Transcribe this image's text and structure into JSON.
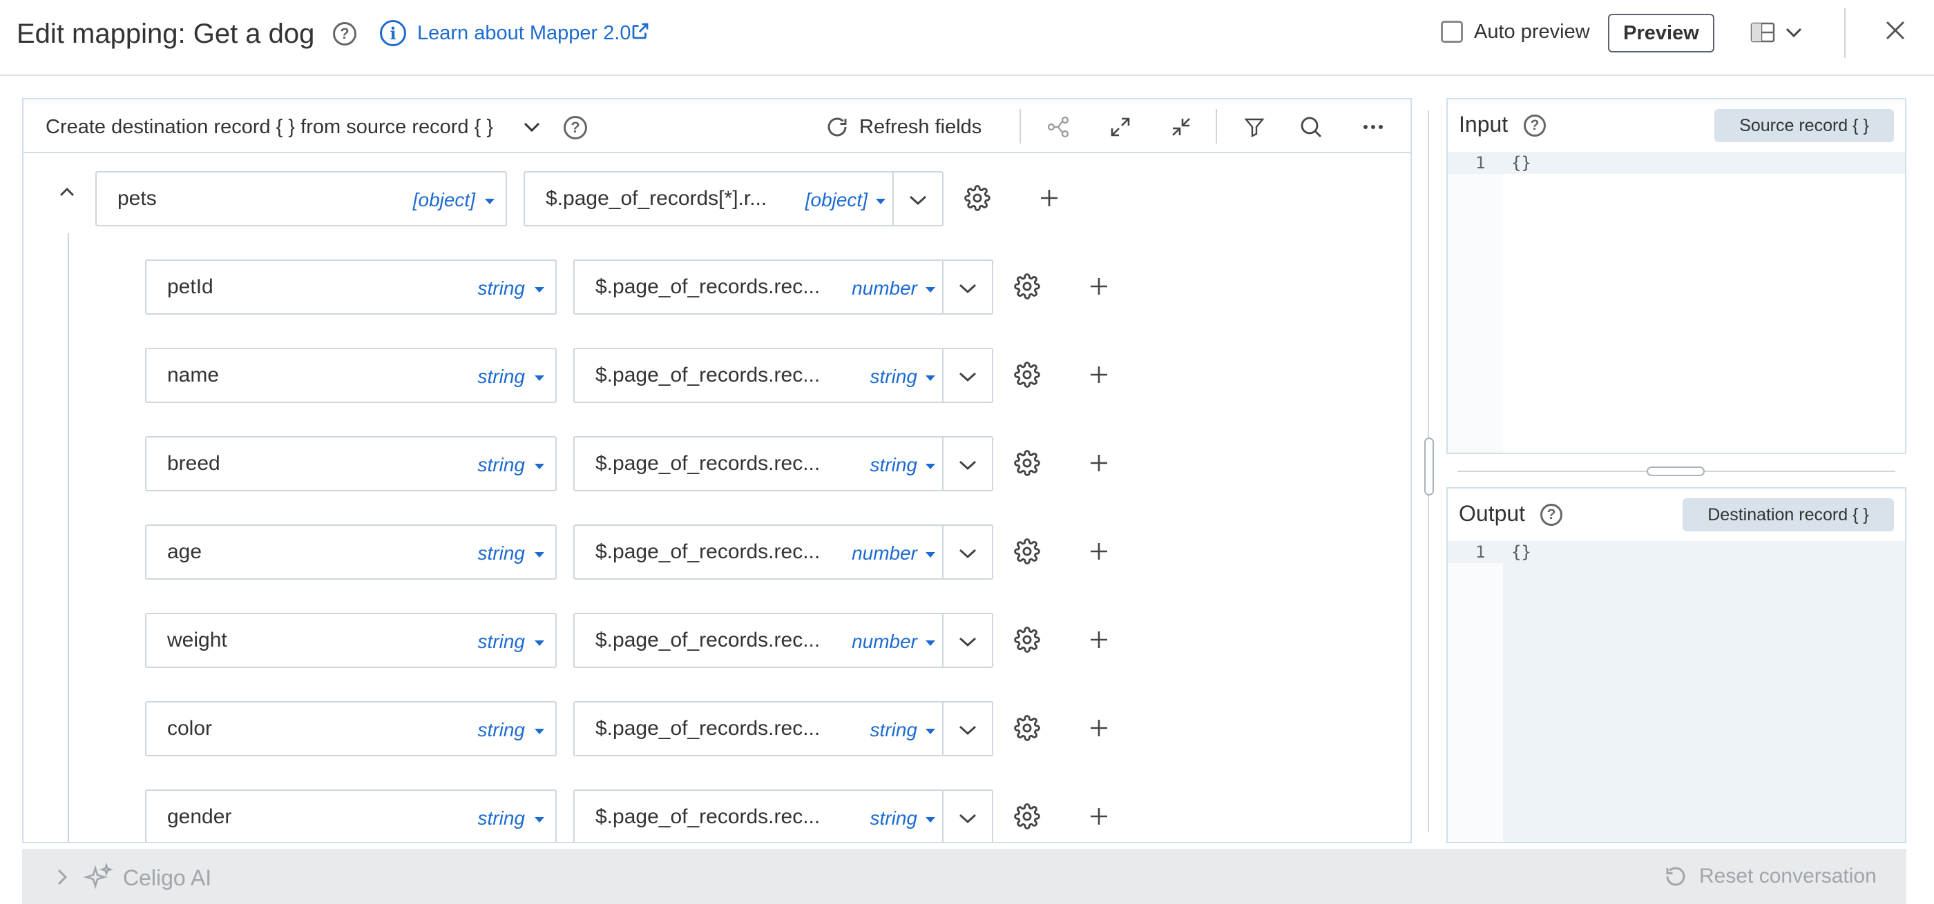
{
  "header": {
    "title": "Edit mapping: Get a dog",
    "learn_link": "Learn about Mapper 2.0",
    "auto_preview_label": "Auto preview",
    "auto_preview_checked": false,
    "preview_button": "Preview"
  },
  "toolbar": {
    "create_label": "Create destination record { } from source record { }",
    "refresh_label": "Refresh fields"
  },
  "parent_row": {
    "name": "pets",
    "type": "[object]",
    "source": "$.page_of_records[*].r...",
    "source_type": "[object]"
  },
  "rows": [
    {
      "name": "petId",
      "type": "string",
      "source": "$.page_of_records.rec...",
      "source_type": "number"
    },
    {
      "name": "name",
      "type": "string",
      "source": "$.page_of_records.rec...",
      "source_type": "string"
    },
    {
      "name": "breed",
      "type": "string",
      "source": "$.page_of_records.rec...",
      "source_type": "string"
    },
    {
      "name": "age",
      "type": "string",
      "source": "$.page_of_records.rec...",
      "source_type": "number"
    },
    {
      "name": "weight",
      "type": "string",
      "source": "$.page_of_records.rec...",
      "source_type": "number"
    },
    {
      "name": "color",
      "type": "string",
      "source": "$.page_of_records.rec...",
      "source_type": "string"
    },
    {
      "name": "gender",
      "type": "string",
      "source": "$.page_of_records.rec...",
      "source_type": "string"
    }
  ],
  "input_panel": {
    "title": "Input",
    "badge": "Source record { }",
    "line_number": "1",
    "code": "{}"
  },
  "output_panel": {
    "title": "Output",
    "badge": "Destination record { }",
    "line_number": "1",
    "code": "{}"
  },
  "ai_bar": {
    "label": "Celigo AI",
    "reset_label": "Reset conversation"
  },
  "colors": {
    "accent": "#1c6bd0",
    "border": "#cfe0ea",
    "badge_bg": "#d7e2ea",
    "ai_bar_bg": "#e8eaec",
    "muted_text": "#a0a6ab"
  }
}
